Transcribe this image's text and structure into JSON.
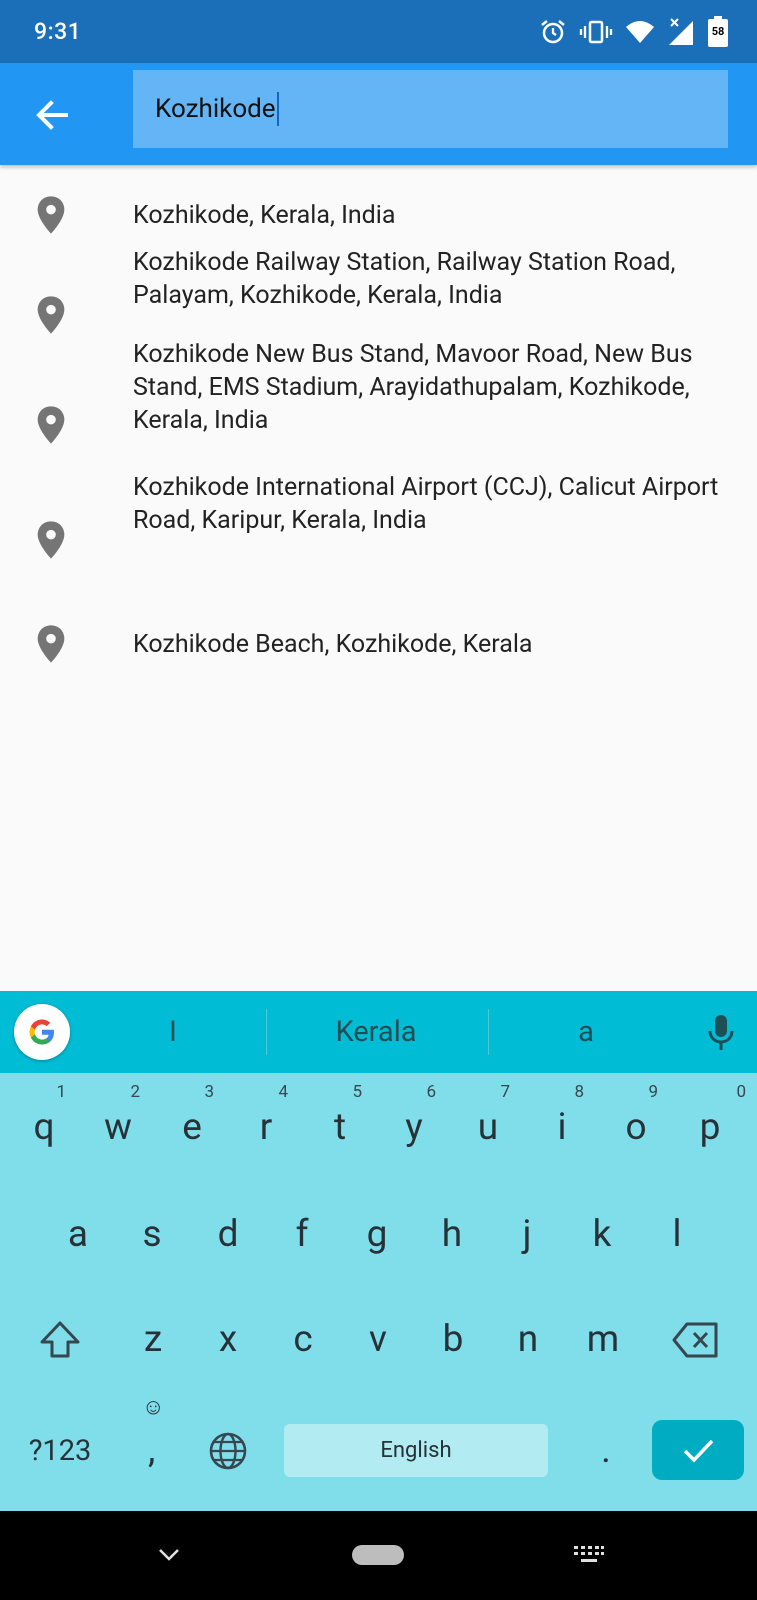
{
  "status_bar": {
    "time": "9:31",
    "battery_level": "58",
    "icons": [
      "alarm-icon",
      "vibrate-icon",
      "wifi-icon",
      "signal-icon",
      "battery-icon"
    ]
  },
  "app_bar": {
    "back_icon": "arrow-back-icon",
    "search_value": "Kozhikode",
    "bg_color": "#2196f3",
    "search_bg_color": "#64b5f6"
  },
  "results": [
    {
      "icon": "location-pin-icon",
      "text": "Kozhikode, Kerala, India"
    },
    {
      "icon": "location-pin-icon",
      "text": "Kozhikode Railway Station, Railway Station Road, Palayam, Kozhikode, Kerala, India"
    },
    {
      "icon": "location-pin-icon",
      "text": "Kozhikode New Bus Stand, Mavoor Road, New Bus Stand, EMS Stadium, Arayidathupalam, Kozhikode, Kerala, India"
    },
    {
      "icon": "location-pin-icon",
      "text": "Kozhikode International Airport (CCJ), Calicut Airport Road, Karipur, Kerala, India"
    },
    {
      "icon": "location-pin-icon",
      "text": "Kozhikode Beach, Kozhikode, Kerala"
    }
  ],
  "keyboard": {
    "suggestions": [
      "I",
      "Kerala",
      "a"
    ],
    "row1": [
      {
        "key": "q",
        "hint": "1"
      },
      {
        "key": "w",
        "hint": "2"
      },
      {
        "key": "e",
        "hint": "3"
      },
      {
        "key": "r",
        "hint": "4"
      },
      {
        "key": "t",
        "hint": "5"
      },
      {
        "key": "y",
        "hint": "6"
      },
      {
        "key": "u",
        "hint": "7"
      },
      {
        "key": "i",
        "hint": "8"
      },
      {
        "key": "o",
        "hint": "9"
      },
      {
        "key": "p",
        "hint": "0"
      }
    ],
    "row2": [
      "a",
      "s",
      "d",
      "f",
      "g",
      "h",
      "j",
      "k",
      "l"
    ],
    "row3": [
      "z",
      "x",
      "c",
      "v",
      "b",
      "n",
      "m"
    ],
    "symbols_label": "?123",
    "comma_label": ",",
    "period_label": ".",
    "space_label": "English",
    "colors": {
      "suggest_bar": "#00bcd4",
      "keys_bg": "#80deea",
      "enter": "#00acc1",
      "space": "#b2ebf2"
    }
  },
  "nav_bar": {
    "icons": [
      "chevron-down-icon",
      "home-pill-icon",
      "keyboard-switch-icon"
    ]
  }
}
